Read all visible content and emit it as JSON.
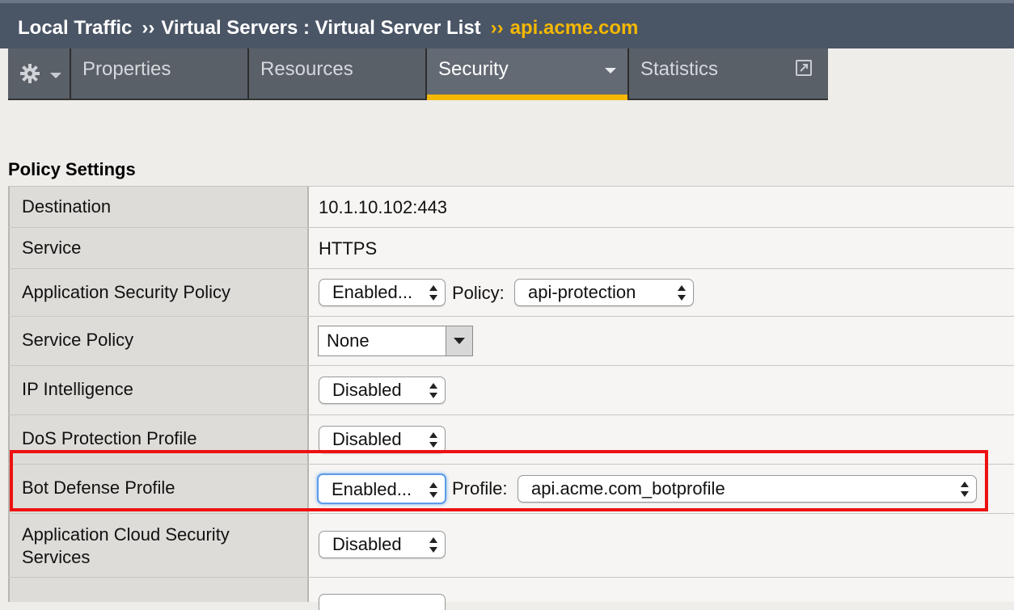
{
  "breadcrumb": {
    "part1": "Local Traffic",
    "sep1": "››",
    "part2": "Virtual Servers : Virtual Server List",
    "sep2": "››",
    "current": "api.acme.com"
  },
  "tabs": {
    "gear_icon": "gear-icon",
    "properties": "Properties",
    "resources": "Resources",
    "security": "Security",
    "statistics": "Statistics",
    "active_color": "#f5b800"
  },
  "section_title": "Policy Settings",
  "rows": {
    "destination": {
      "label": "Destination",
      "value": "10.1.10.102:443"
    },
    "service": {
      "label": "Service",
      "value": "HTTPS"
    },
    "asp": {
      "label": "Application Security Policy",
      "select": "Enabled...",
      "field_label": "Policy:",
      "field_value": "api-protection"
    },
    "service_policy": {
      "label": "Service Policy",
      "value": "None"
    },
    "ip_intel": {
      "label": "IP Intelligence",
      "select": "Disabled"
    },
    "dos": {
      "label": "DoS Protection Profile",
      "select": "Disabled"
    },
    "bot": {
      "label": "Bot Defense Profile",
      "select": "Enabled...",
      "field_label": "Profile:",
      "field_value": "api.acme.com_botprofile"
    },
    "cloud": {
      "label_line1": "Application Cloud Security",
      "label_line2": "Services",
      "select": "Disabled"
    }
  },
  "highlight_color": "#ee1111"
}
